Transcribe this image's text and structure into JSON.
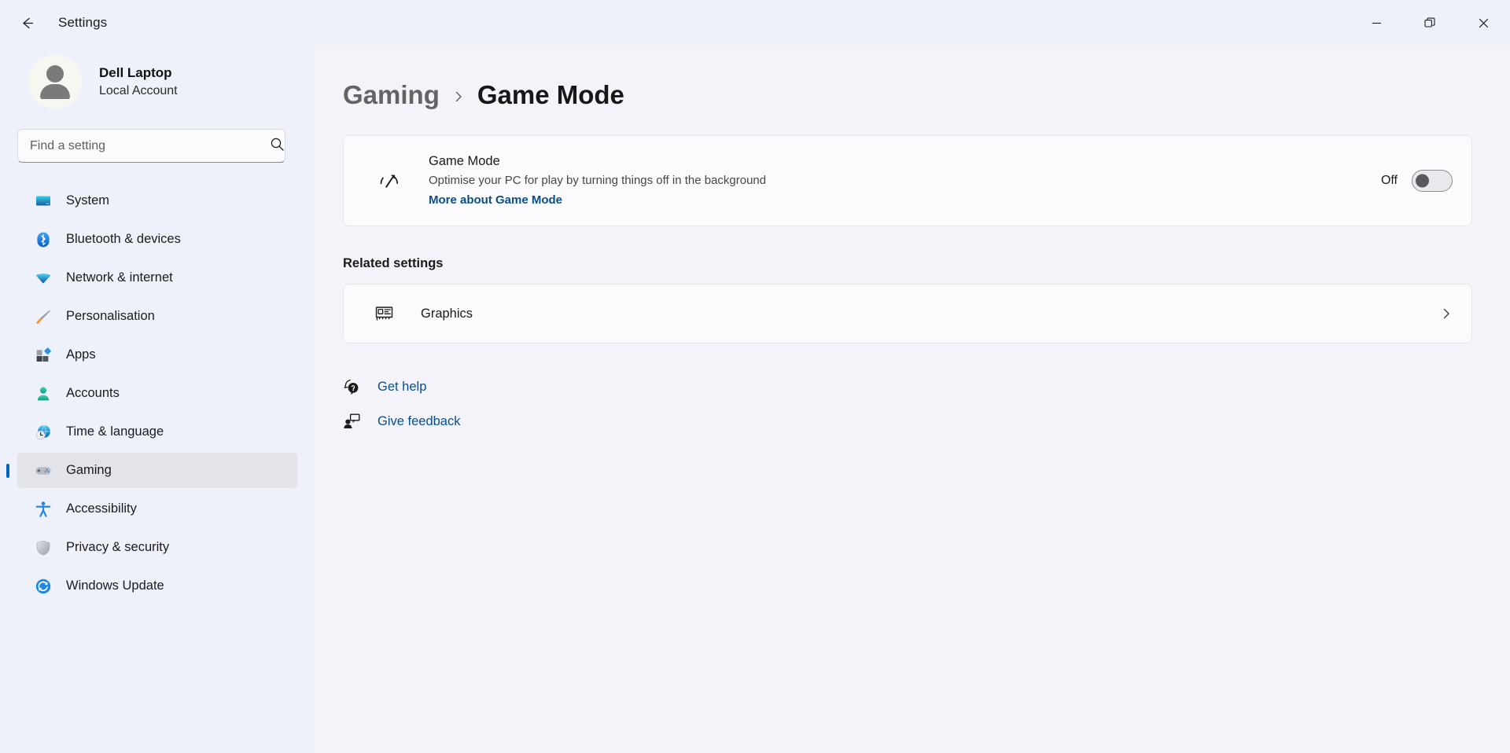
{
  "window": {
    "title": "Settings",
    "back_label": "Back",
    "controls": {
      "minimize": "Minimise",
      "restore": "Restore",
      "close": "Close"
    }
  },
  "account": {
    "name": "Dell Laptop",
    "type": "Local Account"
  },
  "search": {
    "placeholder": "Find a setting",
    "value": ""
  },
  "sidebar": {
    "items": [
      {
        "label": "System",
        "icon": "system-icon",
        "selected": false
      },
      {
        "label": "Bluetooth & devices",
        "icon": "bluetooth-icon",
        "selected": false
      },
      {
        "label": "Network & internet",
        "icon": "network-icon",
        "selected": false
      },
      {
        "label": "Personalisation",
        "icon": "personalisation-icon",
        "selected": false
      },
      {
        "label": "Apps",
        "icon": "apps-icon",
        "selected": false
      },
      {
        "label": "Accounts",
        "icon": "accounts-icon",
        "selected": false
      },
      {
        "label": "Time & language",
        "icon": "time-language-icon",
        "selected": false
      },
      {
        "label": "Gaming",
        "icon": "gaming-icon",
        "selected": true
      },
      {
        "label": "Accessibility",
        "icon": "accessibility-icon",
        "selected": false
      },
      {
        "label": "Privacy & security",
        "icon": "privacy-security-icon",
        "selected": false
      },
      {
        "label": "Windows Update",
        "icon": "windows-update-icon",
        "selected": false
      }
    ]
  },
  "breadcrumb": {
    "parent": "Gaming",
    "separator": "chevron-right-icon",
    "current": "Game Mode"
  },
  "game_mode": {
    "icon": "game-mode-gauge-icon",
    "title": "Game Mode",
    "description": "Optimise your PC for play by turning things off in the background",
    "link": "More about Game Mode",
    "toggle_state_label": "Off",
    "toggle_on": false
  },
  "related_settings": {
    "heading": "Related settings",
    "items": [
      {
        "label": "Graphics",
        "icon": "graphics-card-icon",
        "chevron": "chevron-right-icon"
      }
    ]
  },
  "footer": {
    "links": [
      {
        "label": "Get help",
        "icon": "help-icon"
      },
      {
        "label": "Give feedback",
        "icon": "feedback-icon"
      }
    ]
  },
  "colors": {
    "accent": "#0067c0",
    "link": "#0b4e8c",
    "sidebar_bg": "#eef1fa",
    "content_bg": "#f3f3f9",
    "card_bg": "#fbfbfd",
    "selected_bg": "#e3e4ea"
  }
}
